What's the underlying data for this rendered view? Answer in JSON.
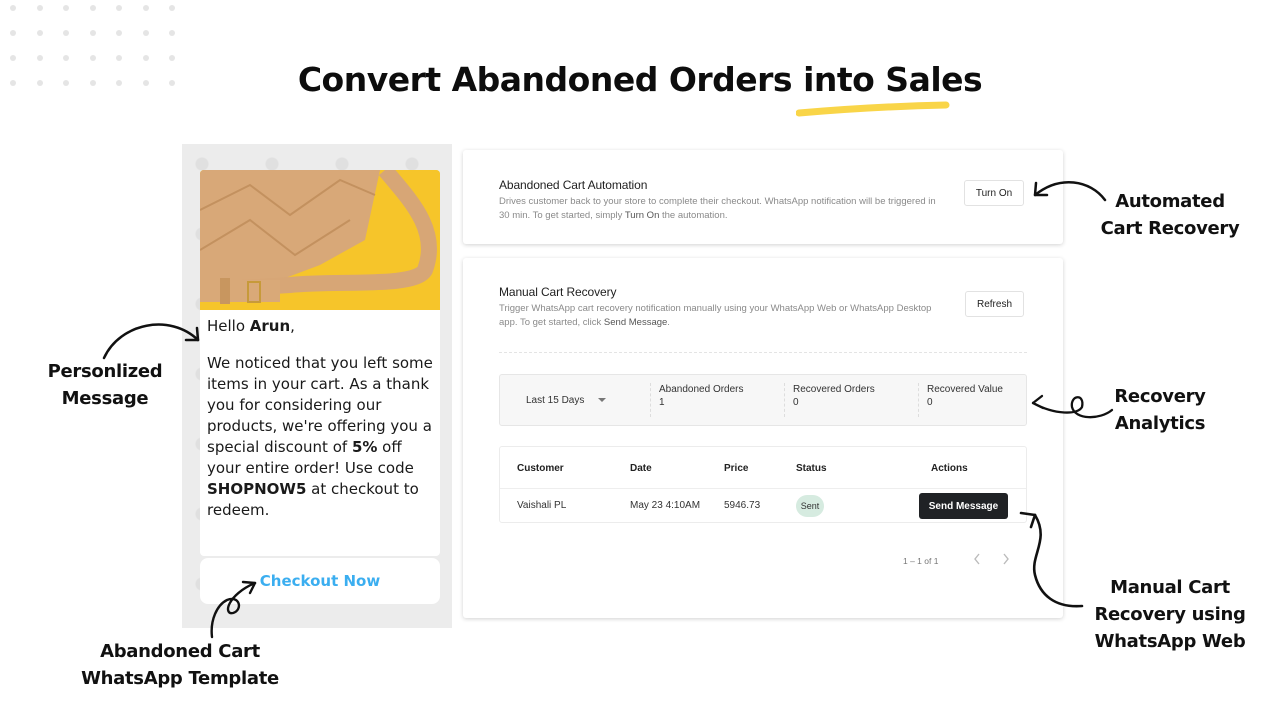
{
  "page": {
    "title": "Convert Abandoned Orders into Sales",
    "accent_color": "#f9d548"
  },
  "template": {
    "greeting_prefix": "Hello ",
    "customer_name": "Arun",
    "greeting_suffix": ",",
    "body_1": "We noticed that you left some items in your cart. As a thank you for considering our products, we're offering you a special discount of ",
    "discount": "5%",
    "body_2": " off your entire order! Use code ",
    "coupon_code": "SHOPNOW5",
    "body_3": " at checkout to redeem.",
    "cta_label": "Checkout Now",
    "cta_color": "#3baef0"
  },
  "automation": {
    "title": "Abandoned Cart Automation",
    "desc_1": "Drives customer back to your store to complete their checkout. WhatsApp notification will be triggered in 30 min. To get started, simply ",
    "desc_emph": "Turn On",
    "desc_2": " the automation.",
    "button_label": "Turn On"
  },
  "manual": {
    "title": "Manual Cart Recovery",
    "desc_1": "Trigger WhatsApp cart recovery notification manually using your WhatsApp Web or WhatsApp Desktop app. To get started, click ",
    "desc_emph": "Send Message",
    "desc_2": ".",
    "refresh_label": "Refresh",
    "range": "Last 15 Days",
    "metrics": [
      {
        "label": "Abandoned Orders",
        "value": "1"
      },
      {
        "label": "Recovered Orders",
        "value": "0"
      },
      {
        "label": "Recovered Value",
        "value": "0"
      }
    ],
    "columns": [
      "Customer",
      "Date",
      "Price",
      "Status",
      "Actions"
    ],
    "rows": [
      {
        "customer": "Vaishali PL",
        "date": "May 23 4:10AM",
        "price": "5946.73",
        "status": "Sent",
        "action": "Send Message"
      }
    ],
    "pagination": "1 – 1 of 1"
  },
  "callouts": {
    "automated_1": "Automated",
    "automated_2": "Cart Recovery",
    "analytics_1": "Recovery",
    "analytics_2": "Analytics",
    "manual_1": "Manual Cart",
    "manual_2": "Recovery using",
    "manual_3": "WhatsApp Web",
    "personalized_1": "Personlized",
    "personalized_2": "Message",
    "template_1": "Abandoned Cart",
    "template_2": "WhatsApp Template"
  }
}
